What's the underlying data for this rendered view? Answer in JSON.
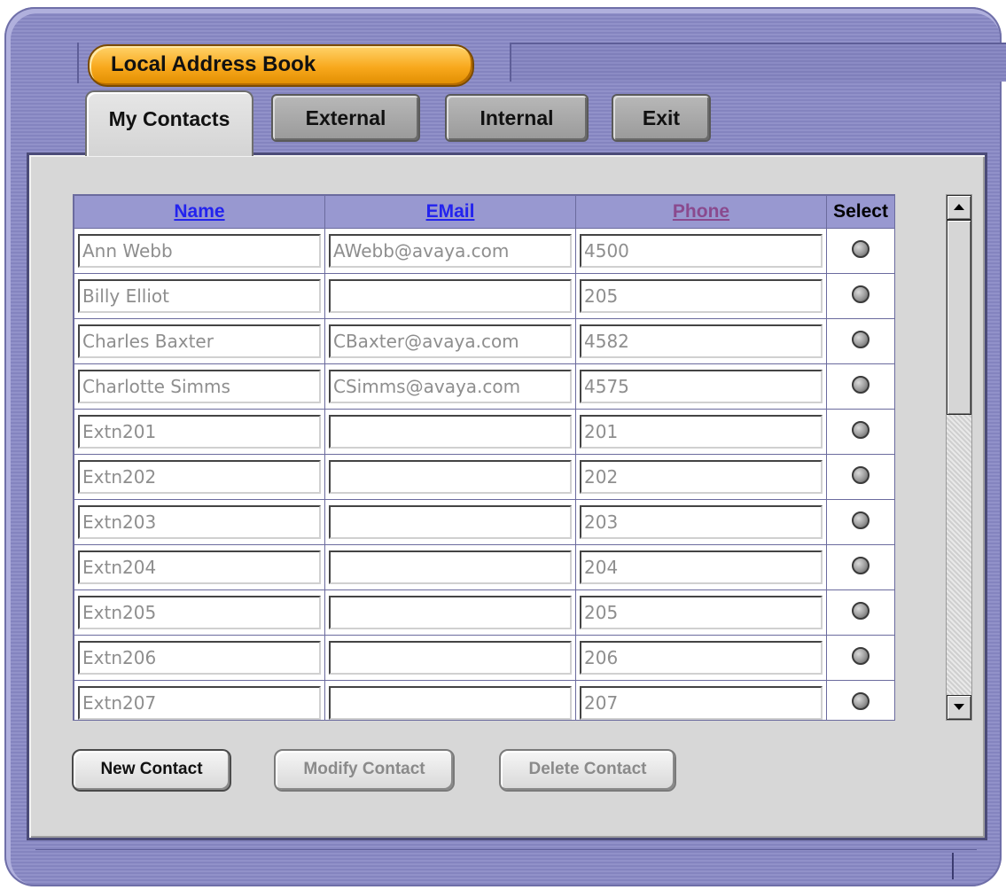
{
  "window": {
    "title": "Local Address Book"
  },
  "tabs": [
    {
      "label": "My Contacts",
      "active": true
    },
    {
      "label": "External",
      "active": false
    },
    {
      "label": "Internal",
      "active": false
    },
    {
      "label": "Exit",
      "active": false
    }
  ],
  "table": {
    "columns": {
      "name": "Name",
      "email": "EMail",
      "phone": "Phone",
      "select": "Select"
    },
    "rows": [
      {
        "name": "Ann Webb",
        "email": "AWebb@avaya.com",
        "phone": "4500"
      },
      {
        "name": "Billy Elliot",
        "email": "",
        "phone": "205"
      },
      {
        "name": "Charles Baxter",
        "email": "CBaxter@avaya.com",
        "phone": "4582"
      },
      {
        "name": "Charlotte Simms",
        "email": "CSimms@avaya.com",
        "phone": "4575"
      },
      {
        "name": "Extn201",
        "email": "",
        "phone": "201"
      },
      {
        "name": "Extn202",
        "email": "",
        "phone": "202"
      },
      {
        "name": "Extn203",
        "email": "",
        "phone": "203"
      },
      {
        "name": "Extn204",
        "email": "",
        "phone": "204"
      },
      {
        "name": "Extn205",
        "email": "",
        "phone": "205"
      },
      {
        "name": "Extn206",
        "email": "",
        "phone": "206"
      },
      {
        "name": "Extn207",
        "email": "",
        "phone": "207"
      }
    ]
  },
  "actions": {
    "new_contact": "New Contact",
    "modify_contact": "Modify Contact",
    "delete_contact": "Delete Contact"
  },
  "colors": {
    "frame": "#8a8ac4",
    "title_pill": "#f8a81c",
    "header_bg": "#9898d0",
    "link_blue": "#2323ee",
    "link_visited": "#8a4a8e"
  }
}
